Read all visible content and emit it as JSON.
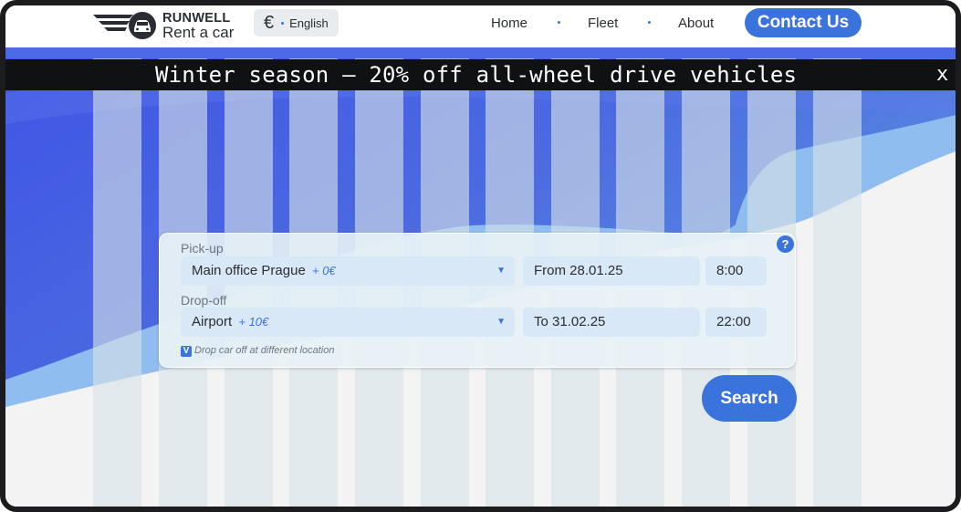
{
  "header": {
    "logo_line1": "RUNWELL",
    "logo_line2": "Rent a car",
    "currency": "€",
    "language": "English",
    "nav": [
      "Home",
      "Fleet",
      "About"
    ],
    "contact_label": "Contact Us"
  },
  "banner": {
    "text": "Winter season – 20% off all-wheel drive vehicles",
    "close": "x"
  },
  "form": {
    "help": "?",
    "pickup": {
      "label": "Pick-up",
      "location": "Main office Prague",
      "surcharge": "+ 0€",
      "date": "From 28.01.25",
      "time": "8:00"
    },
    "dropoff": {
      "label": "Drop-off",
      "location": "Airport",
      "surcharge": "+ 10€",
      "date": "To 31.02.25",
      "time": "22:00"
    },
    "different_location": {
      "checked": true,
      "mark": "V",
      "label": "Drop car off at different location"
    },
    "search_label": "Search"
  },
  "icons": {
    "logo": "car-wings-icon",
    "dropdown": "triangle-down-icon",
    "help": "question-icon",
    "checkbox": "checkbox-icon"
  },
  "colors": {
    "accent": "#3b73dd",
    "hero_blue": "#4a6ae6",
    "hero_light": "#8fbdf0",
    "banner_bg": "#0f1113"
  }
}
